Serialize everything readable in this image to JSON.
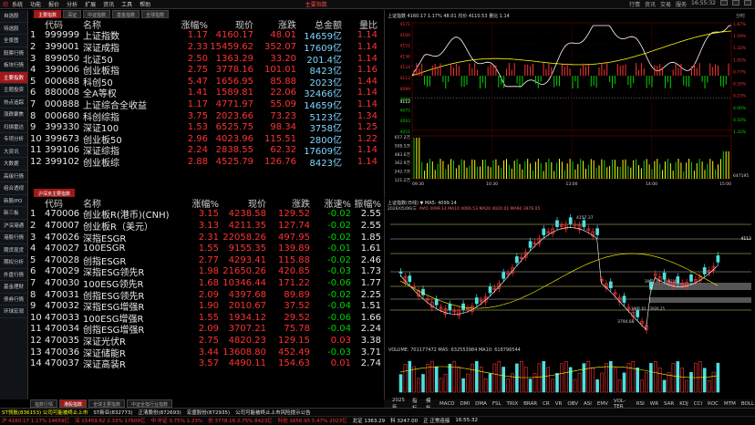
{
  "menubar": {
    "logo": "综",
    "items": [
      "系统",
      "功能",
      "报价",
      "分析",
      "扩展",
      "资讯",
      "工具",
      "帮助"
    ],
    "center": "主要指数",
    "right": [
      "行情",
      "资讯",
      "交易",
      "服务"
    ],
    "clock": "16:55:32"
  },
  "sidebar": {
    "items": [
      "自选股",
      "待选股",
      "全景图",
      "股票行情",
      "板块行情",
      "主要指数",
      "主题投资",
      "热点追踪",
      "涨跌聚焦",
      "扫描雷达",
      "专项分析",
      "大资讯",
      "大数据",
      "高级行情",
      "组合透视",
      "新股IPO",
      "新三板",
      "沪深港通",
      "港股行情",
      "期货现货",
      "期权分析",
      "外盘行情",
      "基金理财",
      "债券行情",
      "环球宏观"
    ]
  },
  "top_tabs": [
    "主要指数",
    "深证",
    "中证指数",
    "基金指数",
    "全球指数"
  ],
  "top_table": {
    "headers": [
      "",
      "代码",
      "名称",
      "涨幅%",
      "现价",
      "涨跌",
      "总金额",
      "量比"
    ],
    "rows": [
      [
        "1",
        "999999",
        "上证指数",
        "1.17",
        "4160.17",
        "48.01",
        "14659亿",
        "1.14"
      ],
      [
        "2",
        "399001",
        "深证成指",
        "2.33",
        "15459.62",
        "352.07",
        "17609亿",
        "1.14"
      ],
      [
        "3",
        "899050",
        "北证50",
        "2.50",
        "1363.29",
        "33.20",
        "201.4亿",
        "1.14"
      ],
      [
        "4",
        "399006",
        "创业板指",
        "2.75",
        "3778.16",
        "101.01",
        "8423亿",
        "1.16"
      ],
      [
        "5",
        "000688",
        "科创50",
        "5.47",
        "1656.95",
        "85.88",
        "2023亿",
        "1.44"
      ],
      [
        "6",
        "880008",
        "全A等权",
        "1.41",
        "1589.81",
        "22.06",
        "32466亿",
        "1.14"
      ],
      [
        "7",
        "000888",
        "上证综合全收益",
        "1.17",
        "4771.97",
        "55.09",
        "14659亿",
        "1.14"
      ],
      [
        "8",
        "000680",
        "科创综指",
        "3.75",
        "2023.66",
        "73.23",
        "5123亿",
        "1.34"
      ],
      [
        "9",
        "399330",
        "深证100",
        "1.53",
        "6525.75",
        "98.34",
        "3758亿",
        "1.25"
      ],
      [
        "10",
        "399673",
        "创业板50",
        "2.96",
        "4023.96",
        "115.51",
        "2800亿",
        "1.22"
      ],
      [
        "11",
        "399106",
        "深证综指",
        "2.24",
        "2838.55",
        "62.32",
        "17609亿",
        "1.14"
      ],
      [
        "12",
        "399102",
        "创业板综",
        "2.88",
        "4525.79",
        "126.76",
        "8423亿",
        "1.14"
      ]
    ]
  },
  "mid_tabs": [
    "沪深京主要指数"
  ],
  "bottom_table": {
    "headers": [
      "",
      "代码",
      "名称",
      "涨幅%",
      "现价",
      "涨跌",
      "涨速%",
      "振幅%"
    ],
    "rows": [
      [
        "1",
        "470006",
        "创业板R(港币)(CNH)",
        "3.15",
        "4238.58",
        "129.52",
        "-0.02",
        "2.55"
      ],
      [
        "2",
        "470007",
        "创业板R（美元）",
        "3.13",
        "4211.35",
        "127.74",
        "-0.02",
        "2.55"
      ],
      [
        "3",
        "470026",
        "深指ESGR",
        "2.31",
        "22058.26",
        "497.95",
        "-0.02",
        "1.85"
      ],
      [
        "4",
        "470027",
        "100ESGR",
        "1.55",
        "9155.35",
        "139.89",
        "-0.01",
        "1.61"
      ],
      [
        "5",
        "470028",
        "创指ESGR",
        "2.77",
        "4293.41",
        "115.88",
        "-0.02",
        "2.46"
      ],
      [
        "6",
        "470029",
        "深指ESG领先R",
        "1.98",
        "21650.26",
        "420.85",
        "-0.03",
        "1.73"
      ],
      [
        "7",
        "470030",
        "100ESG领先R",
        "1.68",
        "10346.44",
        "171.22",
        "-0.06",
        "1.77"
      ],
      [
        "8",
        "470031",
        "创指ESG领先R",
        "2.09",
        "4397.68",
        "89.89",
        "-0.02",
        "2.25"
      ],
      [
        "9",
        "470032",
        "深指ESG增强R",
        "1.90",
        "2010.67",
        "37.52",
        "-0.04",
        "1.51"
      ],
      [
        "10",
        "470033",
        "100ESG增强R",
        "1.55",
        "1934.12",
        "29.52",
        "-0.06",
        "1.66"
      ],
      [
        "11",
        "470034",
        "创指ESG增强R",
        "2.09",
        "3707.21",
        "75.78",
        "-0.04",
        "2.24"
      ],
      [
        "12",
        "470035",
        "深证光伏R",
        "2.75",
        "4820.23",
        "129.15",
        "0.03",
        "3.38"
      ],
      [
        "13",
        "470036",
        "深证储能R",
        "3.44",
        "13608.80",
        "452.49",
        "-0.03",
        "3.71"
      ],
      [
        "14",
        "470037",
        "深证高装R",
        "3.57",
        "4490.11",
        "154.63",
        "0.01",
        "2.74"
      ]
    ]
  },
  "intraday": {
    "title": "上证指数 4160.17 1.17% 48.01 均价 4110.53 量比 1.14",
    "right_label": "分时",
    "left_axis": [
      "4171",
      "4160",
      "4152",
      "4136",
      "4124",
      "4112",
      "4099",
      "4088",
      "4075",
      "4063",
      "4051"
    ],
    "right_axis": [
      "1.87%",
      "1.59%",
      "1.32%",
      "1.05%",
      "0.77%",
      "0.50%",
      "0.23%",
      "0.00%",
      "0.50%",
      "1.32%"
    ],
    "vol_axis": [
      "657.2万",
      "508.5万",
      "483.6万",
      "362.9万",
      "242.7万",
      "121.2万"
    ],
    "times": [
      "09:30",
      "10:30",
      "13:00",
      "14:00",
      "15:00"
    ],
    "cur": "4112",
    "vol_right": "647195"
  },
  "kline": {
    "title": "上证指数(日线) ▼ MA5: 4099.14",
    "date": "2026/05/06/三",
    "ma_line": "MA5 4099.14 MA10 4066.53 MA20 4020.01 MA60 3976.05",
    "top_label": "4157.37",
    "low_label": "3794.68",
    "box1": "3961.26 - 3992.41",
    "box2": "3902.61 - 3926.25",
    "cur": "4112",
    "vol_title": "VOLUME: 701177472 MA5: 632553984 MA10: 618796544"
  },
  "chart_data": {
    "type": "line",
    "title": "上证指数",
    "x": [
      "09:30",
      "10:30",
      "13:00",
      "14:00",
      "15:00"
    ],
    "series": [
      {
        "name": "上证指数",
        "values": [
          4112,
          4135,
          4128,
          4152,
          4160
        ]
      }
    ],
    "ylim": [
      4051,
      4171
    ]
  },
  "indicator_tabs": [
    "2025年",
    "指标",
    "模板",
    "MACD",
    "DMI",
    "DMA",
    "FSL",
    "TRIX",
    "BRAR",
    "CR",
    "VR",
    "OBV",
    "ASI",
    "EMV",
    "VOL-TER",
    "RSI",
    "WR",
    "SAR",
    "KDJ",
    "CCI",
    "ROC",
    "MTM",
    "BOLL"
  ],
  "bottom_tabs": [
    "指数行情",
    "港股指数",
    "全球主要指数",
    "中证全指行业指数"
  ],
  "status": [
    "沪 4160.17 1.17% 14659亿",
    "深 15459.62 2.33% 17609亿",
    "中 中证 3.75% 1.23%",
    "创 3778.16 2.75% 8423亿",
    "科创 1656.95 5.47% 2023亿",
    "北证 1363.29",
    "科 3247.00",
    "正 正常连接",
    "16:55:32"
  ],
  "ticker": [
    "ST领航(836153) 公司可能被终止上市",
    "ST新亚(832773)",
    "正清股份(872693)",
    "宏盛股份(872935)",
    "公司可能被终止上市风险提示公告"
  ],
  "colors": {
    "up": "#ff3232",
    "down": "#00d200",
    "accent": "#a01818",
    "bg": "#000000",
    "yellow": "#ffff00"
  }
}
